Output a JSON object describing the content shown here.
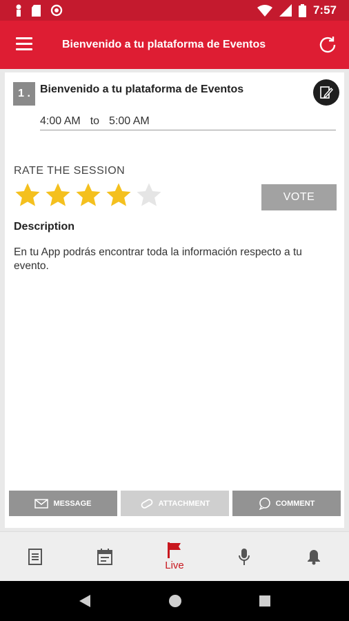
{
  "status_bar": {
    "time": "7:57",
    "left_icons": [
      "person-icon",
      "sd-card-icon",
      "circle-icon"
    ],
    "right_icons": [
      "wifi-icon",
      "signal-icon",
      "battery-icon"
    ]
  },
  "app_bar": {
    "title": "Bienvenido a tu plataforma de Eventos",
    "menu_icon": "hamburger-menu-icon",
    "refresh_icon": "refresh-icon",
    "color": "#de1d33"
  },
  "session": {
    "number": "1 .",
    "title": "Bienvenido a tu plataforma de Eventos",
    "start_time": "4:00 AM",
    "to_label": "to",
    "end_time": "5:00 AM",
    "edit_icon": "edit-note-icon"
  },
  "rating": {
    "label": "RATE THE SESSION",
    "value": 4,
    "max": 5,
    "vote_label": "VOTE",
    "filled_color": "#f4c01e",
    "empty_color": "#e5e5e5"
  },
  "description": {
    "heading": "Description",
    "text": "En tu App podrás encontrar toda la información respecto a tu evento."
  },
  "actions": [
    {
      "label": "MESSAGE",
      "icon": "envelope-icon",
      "enabled": true
    },
    {
      "label": "ATTACHMENT",
      "icon": "paperclip-icon",
      "enabled": false
    },
    {
      "label": "COMMENT",
      "icon": "comment-bubble-icon",
      "enabled": true
    }
  ],
  "bottom_nav": [
    {
      "icon": "document-icon",
      "label": ""
    },
    {
      "icon": "calendar-icon",
      "label": ""
    },
    {
      "icon": "flag-icon",
      "label": "Live",
      "active": true
    },
    {
      "icon": "microphone-icon",
      "label": ""
    },
    {
      "icon": "bell-icon",
      "label": ""
    }
  ],
  "system_nav": [
    "back-icon",
    "home-icon",
    "recents-icon"
  ]
}
